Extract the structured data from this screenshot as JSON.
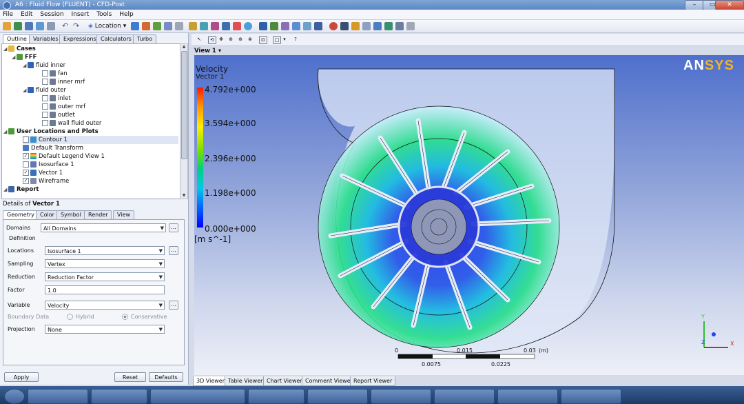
{
  "window": {
    "title": "A6 : Fluid Flow (FLUENT) - CFD-Post"
  },
  "menu": [
    "File",
    "Edit",
    "Session",
    "Insert",
    "Tools",
    "Help"
  ],
  "toolbar": {
    "location_label": "Location"
  },
  "outline_tabs": [
    "Outline",
    "Variables",
    "Expressions",
    "Calculators",
    "Turbo"
  ],
  "tree": {
    "cases": "Cases",
    "fff": "FFF",
    "fluid_inner": "fluid inner",
    "fan": "fan",
    "inner_mrf": "inner mrf",
    "fluid_outer": "fluid outer",
    "inlet": "inlet",
    "outer_mrf": "outer mrf",
    "outlet": "outlet",
    "wall_fluid_outer": "wall fluid outer",
    "user_locations": "User Locations and Plots",
    "contour1": "Contour 1",
    "default_transform": "Default Transform",
    "default_legend": "Default Legend View 1",
    "isosurface1": "Isosurface 1",
    "vector1": "Vector 1",
    "wireframe": "Wireframe",
    "report": "Report"
  },
  "details": {
    "title_prefix": "Details of ",
    "title_object": "Vector 1",
    "tabs": [
      "Geometry",
      "Color",
      "Symbol",
      "Render",
      "View"
    ],
    "domains_label": "Domains",
    "domains_value": "All Domains",
    "definition_label": "Definition",
    "locations_label": "Locations",
    "locations_value": "Isosurface 1",
    "sampling_label": "Sampling",
    "sampling_value": "Vertex",
    "reduction_label": "Reduction",
    "reduction_value": "Reduction Factor",
    "factor_label": "Factor",
    "factor_value": "1.0",
    "variable_label": "Variable",
    "variable_value": "Velocity",
    "boundary_label": "Boundary Data",
    "hybrid_label": "Hybrid",
    "conservative_label": "Conservative",
    "projection_label": "Projection",
    "projection_value": "None",
    "apply": "Apply",
    "reset": "Reset",
    "defaults": "Defaults"
  },
  "viewer": {
    "view_label": "View 1",
    "legend_title": "Velocity",
    "legend_sub": "Vector 1",
    "legend_values": [
      "4.792e+000",
      "3.594e+000",
      "2.396e+000",
      "1.198e+000",
      "0.000e+000"
    ],
    "legend_unit": "[m s^-1]",
    "logo_an": "AN",
    "logo_sys": "SYS",
    "scale_top": [
      "0",
      "0.015",
      "0.03",
      "(m)"
    ],
    "scale_bottom": [
      "0.0075",
      "0.0225"
    ],
    "axis_y": "Y",
    "axis_x": "X",
    "axis_z": "Z"
  },
  "bottom_tabs": [
    "3D Viewer",
    "Table Viewer",
    "Chart Viewer",
    "Comment Viewer",
    "Report Viewer"
  ],
  "colors": {
    "accent": "#5a86c2",
    "ansys_yellow": "#f0b429"
  }
}
